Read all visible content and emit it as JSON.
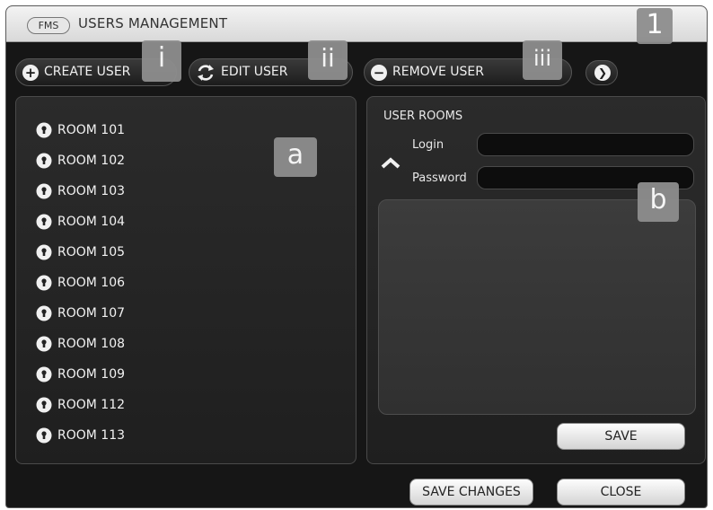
{
  "window": {
    "badge": "FMS",
    "title": "USERS MANAGEMENT"
  },
  "toolbar": {
    "create_label": "CREATE USER",
    "edit_label": "EDIT USER",
    "remove_label": "REMOVE USER"
  },
  "markers": {
    "window": "1",
    "create": "i",
    "edit": "ii",
    "remove": "iii",
    "rooms_panel": "a",
    "user_panel": "b"
  },
  "rooms": [
    {
      "label": "ROOM 101"
    },
    {
      "label": "ROOM 102"
    },
    {
      "label": "ROOM 103"
    },
    {
      "label": "ROOM 104"
    },
    {
      "label": "ROOM 105"
    },
    {
      "label": "ROOM 106"
    },
    {
      "label": "ROOM 107"
    },
    {
      "label": "ROOM 108"
    },
    {
      "label": "ROOM 109"
    },
    {
      "label": "ROOM 112"
    },
    {
      "label": "ROOM 113"
    }
  ],
  "user_panel": {
    "title": "USER ROOMS",
    "login_label": "Login",
    "login_value": "",
    "password_label": "Password",
    "password_value": "",
    "save_label": "SAVE"
  },
  "footer": {
    "save_changes_label": "SAVE CHANGES",
    "close_label": "CLOSE"
  }
}
